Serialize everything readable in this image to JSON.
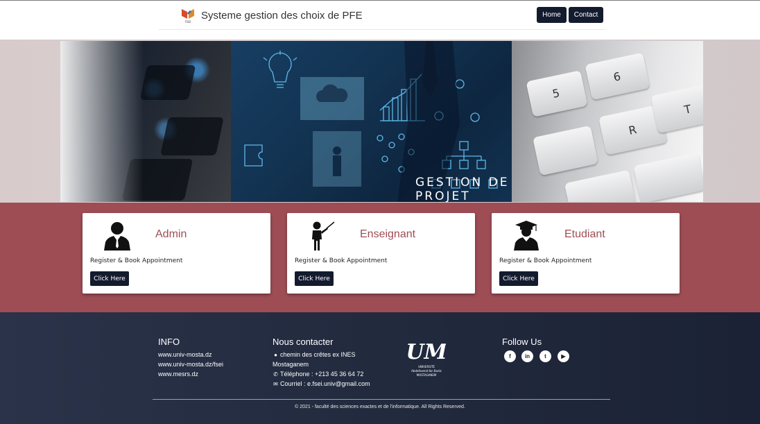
{
  "header": {
    "title": "Systeme gestion des choix de PFE",
    "logo_text": "FSEI",
    "nav": {
      "home": "Home",
      "contact": "Contact"
    }
  },
  "banner": {
    "caption": "GESTION DE PROJET",
    "keyboard_labels": [
      "5",
      "6",
      "T",
      "R"
    ]
  },
  "cards": [
    {
      "title": "Admin",
      "description": "Register & Book Appointment",
      "button": "Click Here",
      "icon": "admin-user-icon"
    },
    {
      "title": "Enseignant",
      "description": "Register & Book Appointment",
      "button": "Click Here",
      "icon": "teacher-icon"
    },
    {
      "title": "Etudiant",
      "description": "Register & Book Appointment",
      "button": "Click Here",
      "icon": "graduate-icon"
    }
  ],
  "footer": {
    "info": {
      "heading": "INFO",
      "links": [
        "www.univ-mosta.dz",
        "www.univ-mosta.dz/fsei",
        "www.mesrs.dz"
      ]
    },
    "contact": {
      "heading": "Nous contacter",
      "address_line1": "chemin des crêtes ex INES",
      "address_line2": "Mostaganem",
      "phone": "Téléphone : +213 45 36 64 72",
      "email": "Courriel : e.fsei.univ@gmail.com"
    },
    "university_logo": {
      "mark": "UM",
      "line1": "UNIVERSITÉ",
      "line2": "Abdelhamid Ibn Badis",
      "line3": "MOSTAGANEM"
    },
    "follow": {
      "heading": "Follow Us",
      "networks": [
        "facebook",
        "linkedin",
        "twitter",
        "youtube"
      ],
      "glyphs": [
        "f",
        "in",
        "t",
        "▶"
      ]
    },
    "copyright": "© 2021 - faculté des sciences exactes et de l'informatique. All Rights Reserved."
  },
  "colors": {
    "accent": "#9e4d55",
    "navy": "#131b2e",
    "footer_bg": "#222a3e"
  }
}
